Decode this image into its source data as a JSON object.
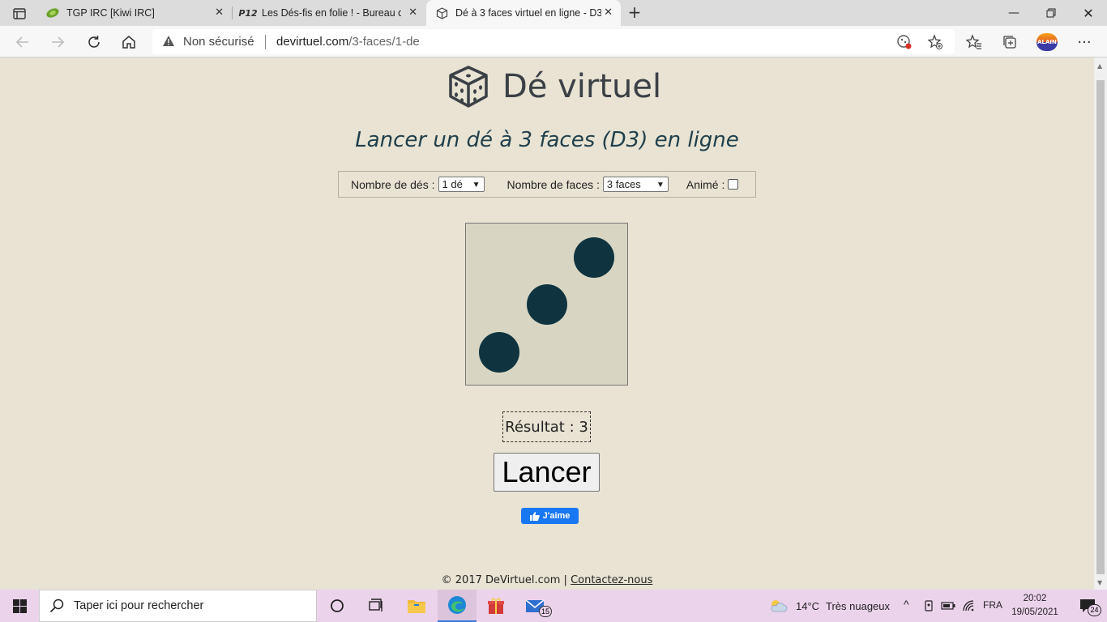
{
  "browser": {
    "tabs": [
      {
        "title": "TGP IRC [Kiwi IRC]",
        "active": false
      },
      {
        "title": "Les Dés-fis en folie ! - Bureau de",
        "active": false,
        "favicon_text": "P12"
      },
      {
        "title": "Dé à 3 faces virtuel en ligne - D3",
        "active": true
      }
    ],
    "security_label": "Non sécurisé",
    "url_host": "devirtuel.com",
    "url_path": "/3-faces/1-de",
    "profile_badge": "ALAIN"
  },
  "page": {
    "logo_text": "Dé virtuel",
    "subtitle": "Lancer un dé à 3 faces (D3) en ligne",
    "options": {
      "dice_label": "Nombre de dés :",
      "dice_value": "1 dé",
      "faces_label": "Nombre de faces :",
      "faces_value": "3 faces",
      "animated_label": "Animé :",
      "animated_checked": false
    },
    "die_value": 3,
    "result_text": "Résultat : 3",
    "roll_button": "Lancer",
    "like_button": "J'aime",
    "footer_copyright": "© 2017 DeVirtuel.com |",
    "footer_contact": "Contactez-nous"
  },
  "taskbar": {
    "search_placeholder": "Taper ici pour rechercher",
    "mail_badge": "15",
    "weather_temp": "14°C",
    "weather_desc": "Très nuageux",
    "language": "FRA",
    "time": "20:02",
    "date": "19/05/2021",
    "notification_count": "24"
  },
  "colors": {
    "page_background": "#e8e3d2",
    "pip": "#0f3440",
    "subtitle": "#1f3f4c",
    "facebook": "#1877f2"
  }
}
